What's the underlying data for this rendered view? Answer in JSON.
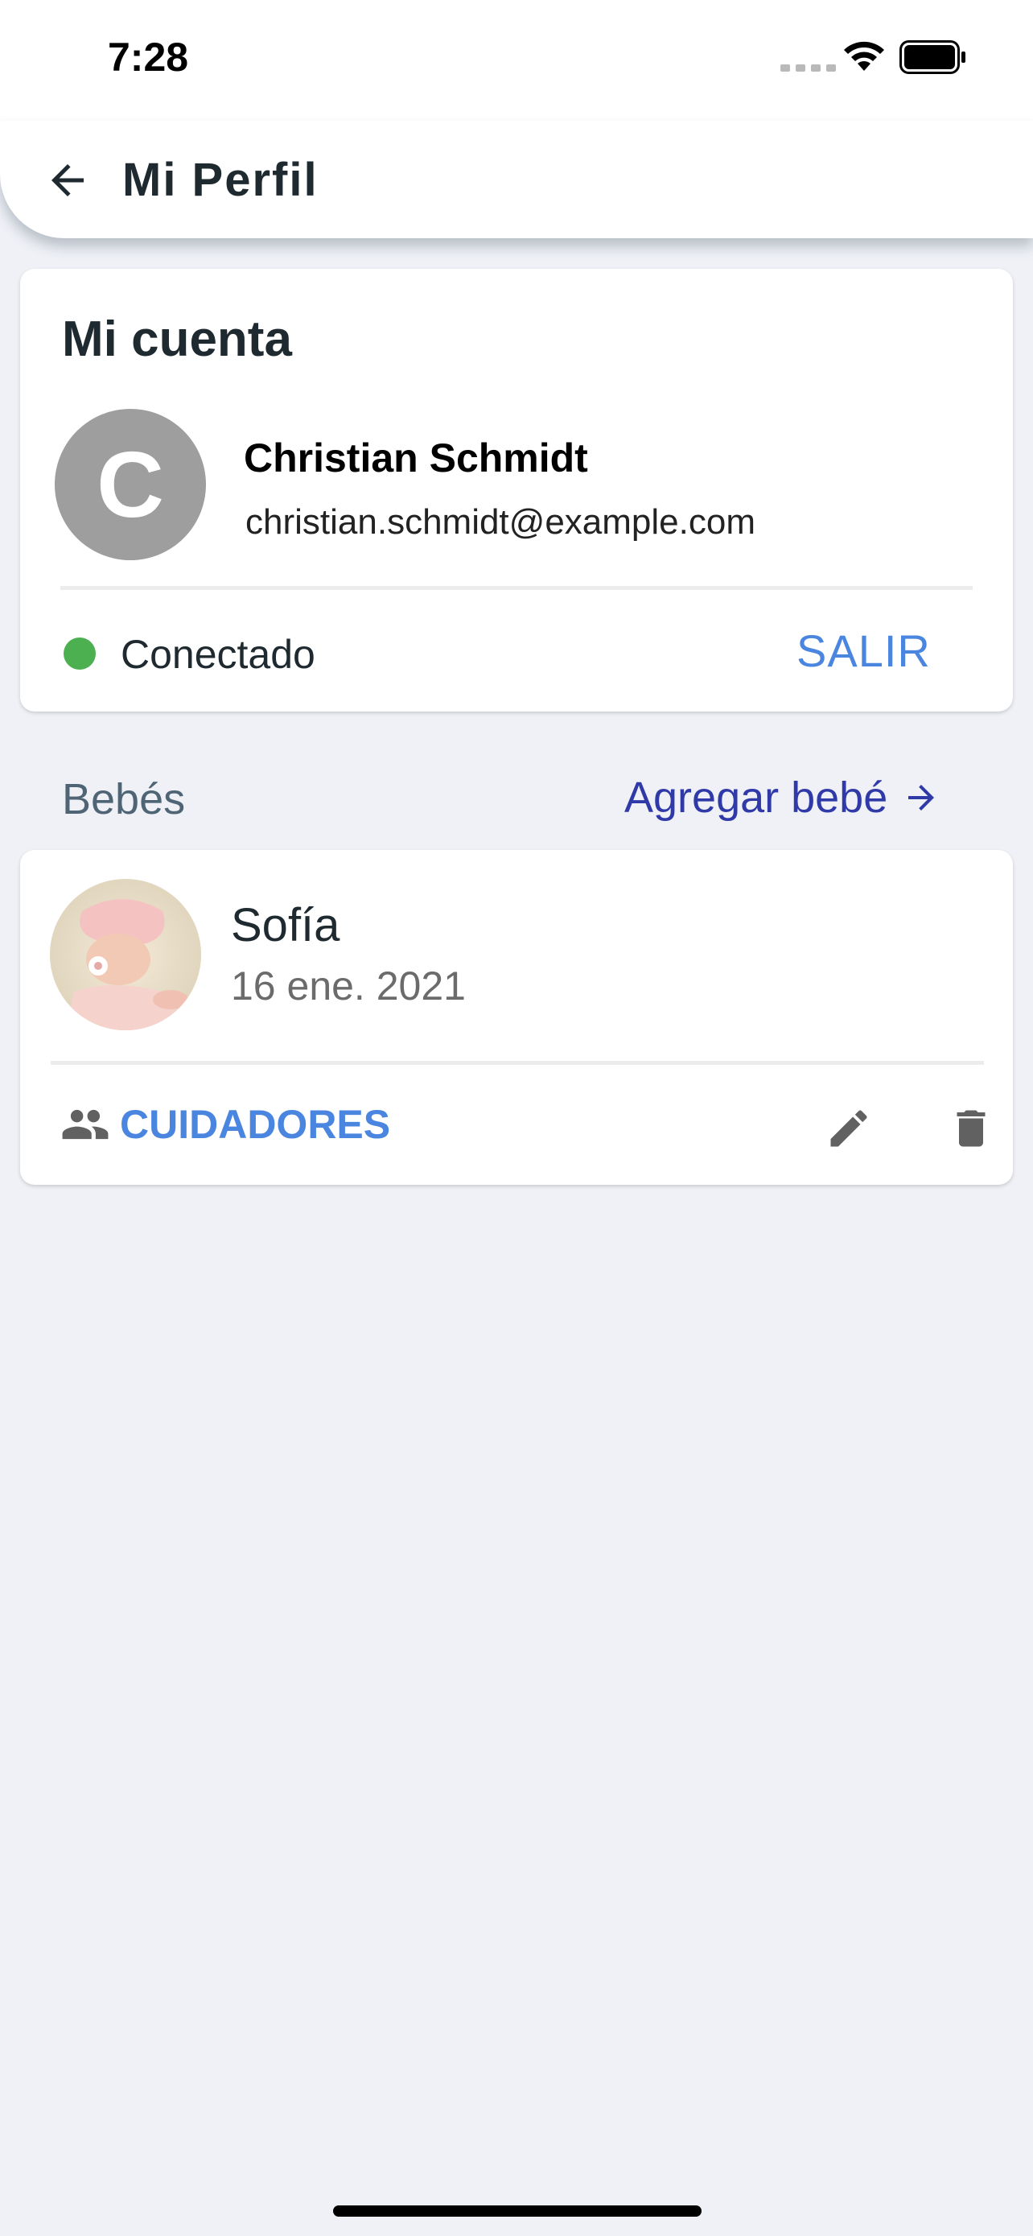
{
  "status_bar": {
    "time": "7:28"
  },
  "app_bar": {
    "title": "Mi Perfil",
    "back_icon": "arrow-back-icon"
  },
  "account": {
    "title": "Mi cuenta",
    "avatar_initial": "C",
    "name": "Christian Schmidt",
    "email": "christian.schmidt@example.com",
    "status": "Conectado",
    "status_color": "#4caf50",
    "logout_label": "SALIR"
  },
  "babies_section": {
    "title": "Bebés",
    "add_label": "Agregar bebé"
  },
  "babies": [
    {
      "name": "Sofía",
      "birth_date": "16 ene. 2021",
      "caregivers_label": "CUIDADORES"
    }
  ],
  "colors": {
    "accent": "#4a86e0",
    "link": "#2f3aa8",
    "background": "#eff1f6"
  }
}
